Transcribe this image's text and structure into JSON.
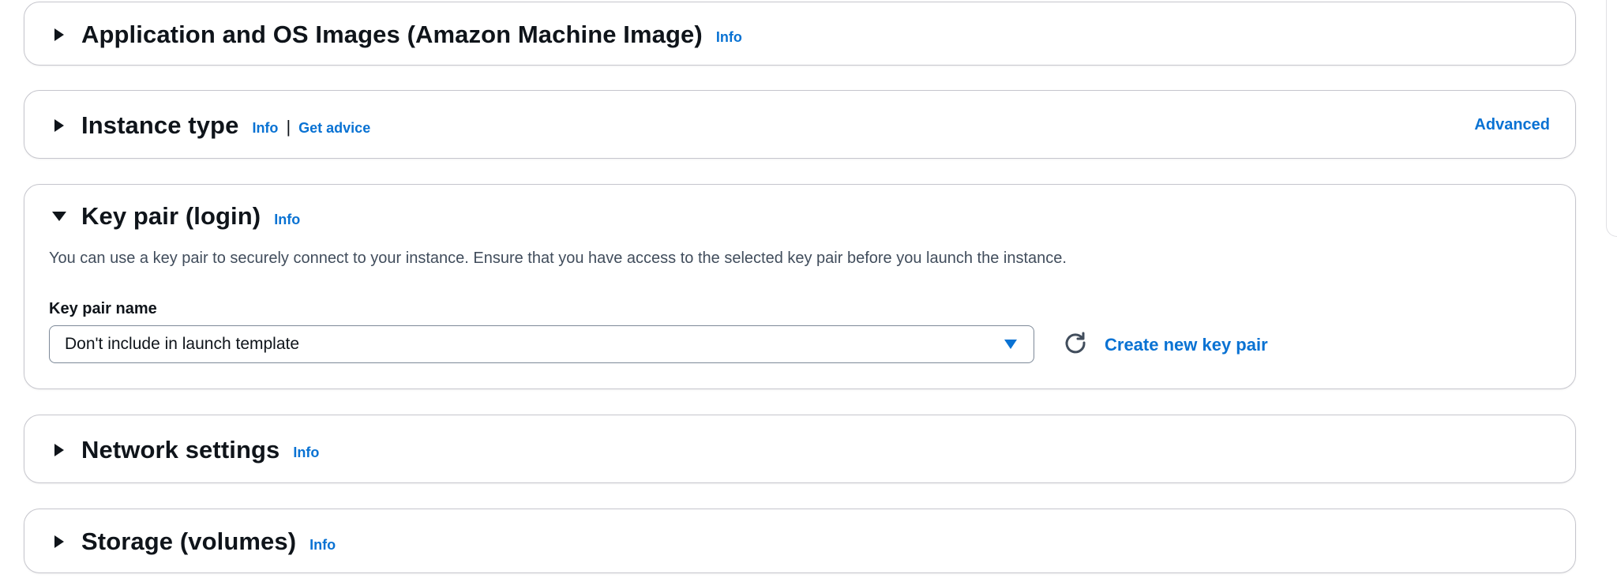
{
  "sections": {
    "ami": {
      "title": "Application and OS Images (Amazon Machine Image)",
      "info": "Info"
    },
    "instance_type": {
      "title": "Instance type",
      "info": "Info",
      "separator": "|",
      "advice": "Get advice",
      "advanced": "Advanced"
    },
    "key_pair": {
      "title": "Key pair (login)",
      "info": "Info",
      "description": "You can use a key pair to securely connect to your instance. Ensure that you have access to the selected key pair before you launch the instance.",
      "field_label": "Key pair name",
      "selected_value": "Don't include in launch template",
      "create_link": "Create new key pair"
    },
    "network": {
      "title": "Network settings",
      "info": "Info"
    },
    "storage": {
      "title": "Storage (volumes)",
      "info": "Info"
    }
  },
  "colors": {
    "link": "#0972d3",
    "text": "#0f141a",
    "border": "#c6c6cd"
  },
  "icons": {
    "collapsed": "caret-right-icon",
    "expanded": "caret-down-icon",
    "dropdown": "triangle-down-icon",
    "refresh": "refresh-icon"
  }
}
